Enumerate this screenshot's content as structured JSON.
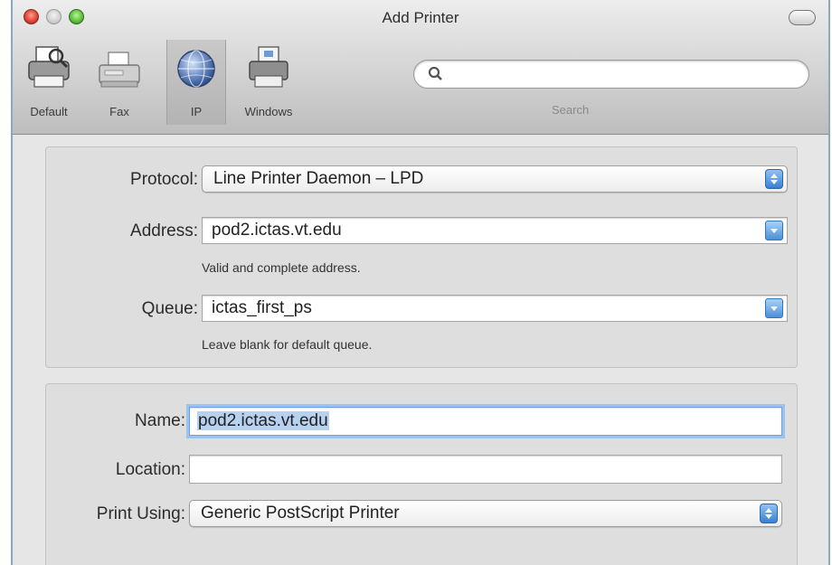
{
  "window": {
    "title": "Add Printer"
  },
  "toolbar": {
    "tools": [
      {
        "label": "Default",
        "icon": "printer-icon"
      },
      {
        "label": "Fax",
        "icon": "fax-icon"
      },
      {
        "label": "IP",
        "icon": "globe-icon"
      },
      {
        "label": "Windows",
        "icon": "windows-printer-icon"
      }
    ],
    "selected_tool": "IP",
    "search": {
      "value": "",
      "placeholder": "",
      "label": "Search"
    }
  },
  "connection": {
    "protocol_label": "Protocol:",
    "protocol_value": "Line Printer Daemon – LPD",
    "address_label": "Address:",
    "address_value": "pod2.ictas.vt.edu",
    "address_hint": "Valid and complete address.",
    "queue_label": "Queue:",
    "queue_value": "ictas_first_ps",
    "queue_hint": "Leave blank for default queue."
  },
  "details": {
    "name_label": "Name:",
    "name_value": "pod2.ictas.vt.edu",
    "location_label": "Location:",
    "location_value": "",
    "print_using_label": "Print Using:",
    "print_using_value": "Generic PostScript Printer"
  },
  "colors": {
    "selection": "#b7d1f1",
    "focus_ring": "#9cc3ec",
    "stepper": "#3a7fd0"
  }
}
